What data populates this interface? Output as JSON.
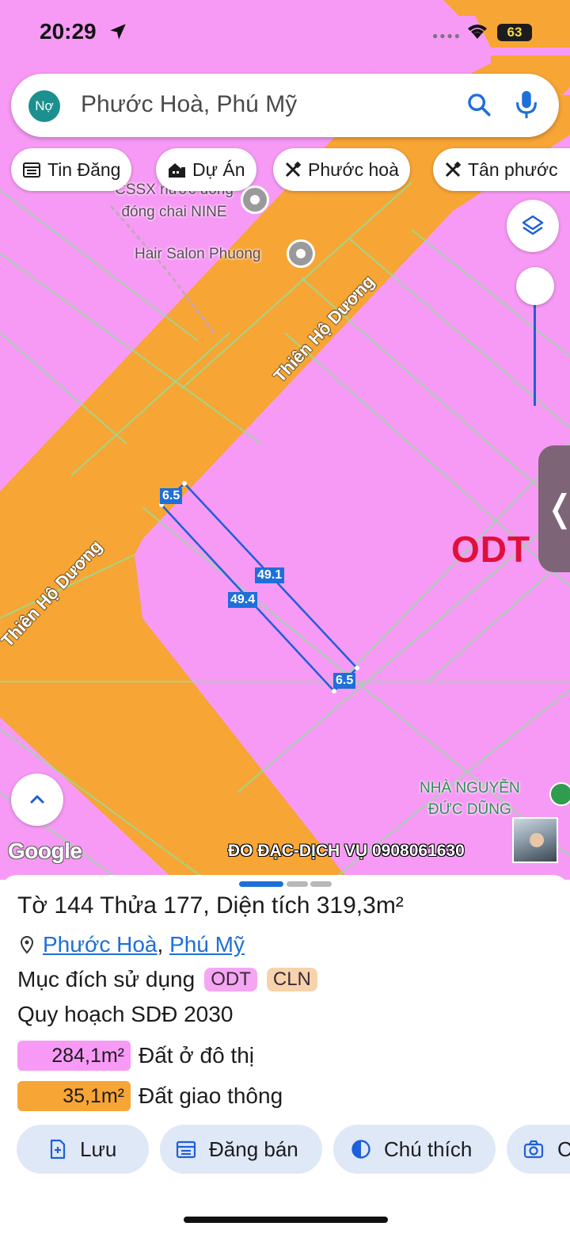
{
  "status_bar": {
    "time": "20:29",
    "battery": "63"
  },
  "search": {
    "avatar_text": "Nợ",
    "text": "Phước Hoà, Phú Mỹ"
  },
  "chips": [
    "Tin Đăng",
    "Dự Án",
    "Phước hoà",
    "Tân phước"
  ],
  "map": {
    "poi_nine": "CSSX nước uống đóng chai NINE",
    "poi_salon": "Hair Salon Phuong",
    "poi_nguyen_line1": "NHÀ NGUYỄN",
    "poi_nguyen_line2": "ĐỨC DŨNG",
    "street": "Thiên Hộ Dương",
    "zone": "ODT",
    "measure_top": "6.5",
    "measure_right": "49.1",
    "measure_left": "49.4",
    "measure_bottom": "6.5",
    "google": "Google",
    "watermark": "ĐO ĐẠC-DỊCH VỤ 0908061630",
    "colors": {
      "residential": "#f79af5",
      "road": "#f7a535",
      "lot_outline": "#1e5fd9"
    }
  },
  "parcel": {
    "title": "Tờ 144 Thửa 177, Diện tích 319,3m²",
    "ward": "Phước Hoà",
    "district": "Phú Mỹ",
    "purpose_label": "Mục đích sử dụng",
    "purpose_tags": [
      {
        "code": "ODT",
        "color": "#f5a6f3"
      },
      {
        "code": "CLN",
        "color": "#f7d3ab"
      }
    ],
    "plan_label": "Quy hoạch SDĐ 2030",
    "areas": [
      {
        "value": "284,1m²",
        "label": "Đất ở đô thị",
        "color": "#f79af5"
      },
      {
        "value": "35,1m²",
        "label": "Đất giao thông",
        "color": "#f7a535"
      }
    ]
  },
  "actions": [
    "Lưu",
    "Đăng bán",
    "Chú thích",
    "C"
  ]
}
